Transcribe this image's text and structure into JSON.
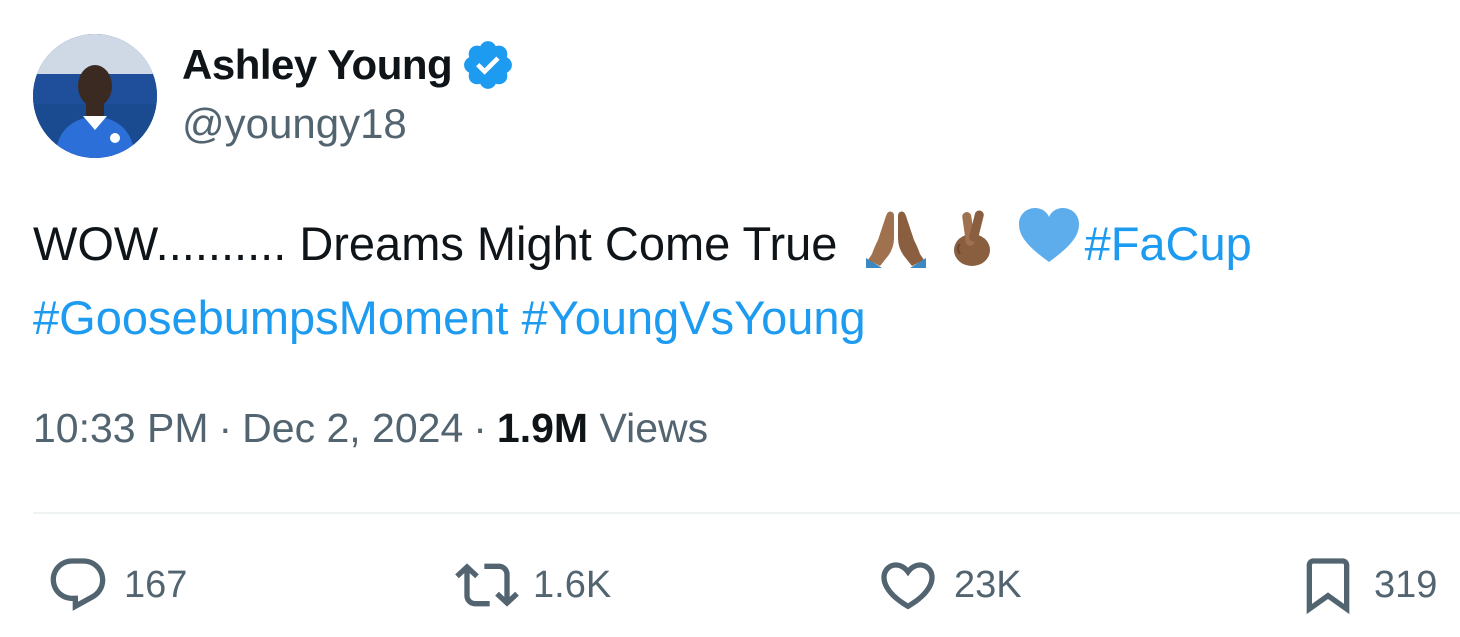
{
  "author": {
    "display_name": "Ashley Young",
    "handle": "@youngy18",
    "verified": true,
    "avatar": "profile photo in blue football kit"
  },
  "tweet": {
    "text_main": "WOW.......... Dreams Might Come True",
    "emojis": [
      "folded-hands-medium-dark",
      "crossed-fingers-medium-dark",
      "blue-heart"
    ],
    "hashtags": [
      "#FaCup",
      "#GoosebumpsMoment",
      "#YoungVsYoung"
    ]
  },
  "meta": {
    "time": "10:33 PM",
    "separator": "·",
    "date": "Dec 2, 2024",
    "views_count": "1.9M",
    "views_label": "Views"
  },
  "actions": {
    "reply_count": "167",
    "retweet_count": "1.6K",
    "like_count": "23K",
    "bookmark_count": "319"
  },
  "colors": {
    "link": "#1d9bf0",
    "secondary_text": "#536471",
    "primary_text": "#0f1419",
    "verified_badge": "#1d9bf0",
    "divider": "#eff3f4"
  }
}
